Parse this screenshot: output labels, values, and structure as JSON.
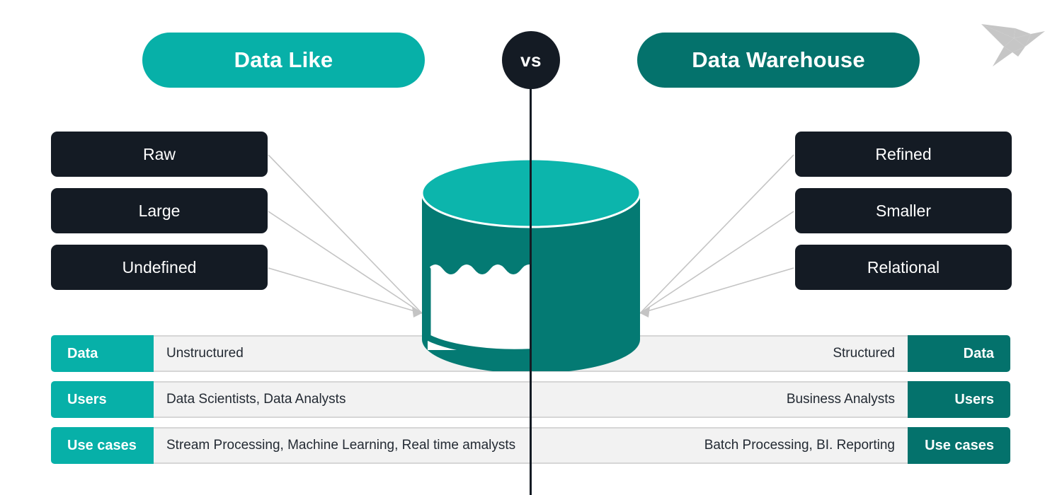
{
  "logo": {
    "icon": "origami-bird-logo",
    "color": "#c6c6c6"
  },
  "headers": {
    "left": {
      "label": "Data Like",
      "color": "#07b0a8"
    },
    "right": {
      "label": "Data Warehouse",
      "color": "#04726c"
    },
    "versus": {
      "label": "vs",
      "color": "#141b24"
    }
  },
  "attributes": {
    "left": [
      {
        "label": "Raw"
      },
      {
        "label": "Large"
      },
      {
        "label": "Undefined"
      }
    ],
    "right": [
      {
        "label": "Refined"
      },
      {
        "label": "Smaller"
      },
      {
        "label": "Relational"
      }
    ],
    "box_color": "#141b24"
  },
  "illustration": {
    "name": "database-cylinder",
    "top_color": "#0cb5ac",
    "body_color": "#047a73",
    "fill_color": "#ffffff",
    "connector_color": "#c4c4c4"
  },
  "table": {
    "rows": [
      {
        "label_left": "Data",
        "value_left": "Unstructured",
        "value_right": "Structured",
        "label_right": "Data"
      },
      {
        "label_left": "Users",
        "value_left": "Data Scientists, Data Analysts",
        "value_right": "Business Analysts",
        "label_right": "Users"
      },
      {
        "label_left": "Use cases",
        "value_left": "Stream Processing, Machine Learning, Real time amalysts",
        "value_right": "Batch Processing, BI. Reporting",
        "label_right": "Use cases"
      }
    ],
    "left_label_color": "#07b0a8",
    "right_label_color": "#04726c",
    "value_bg_color": "#f2f2f2"
  }
}
